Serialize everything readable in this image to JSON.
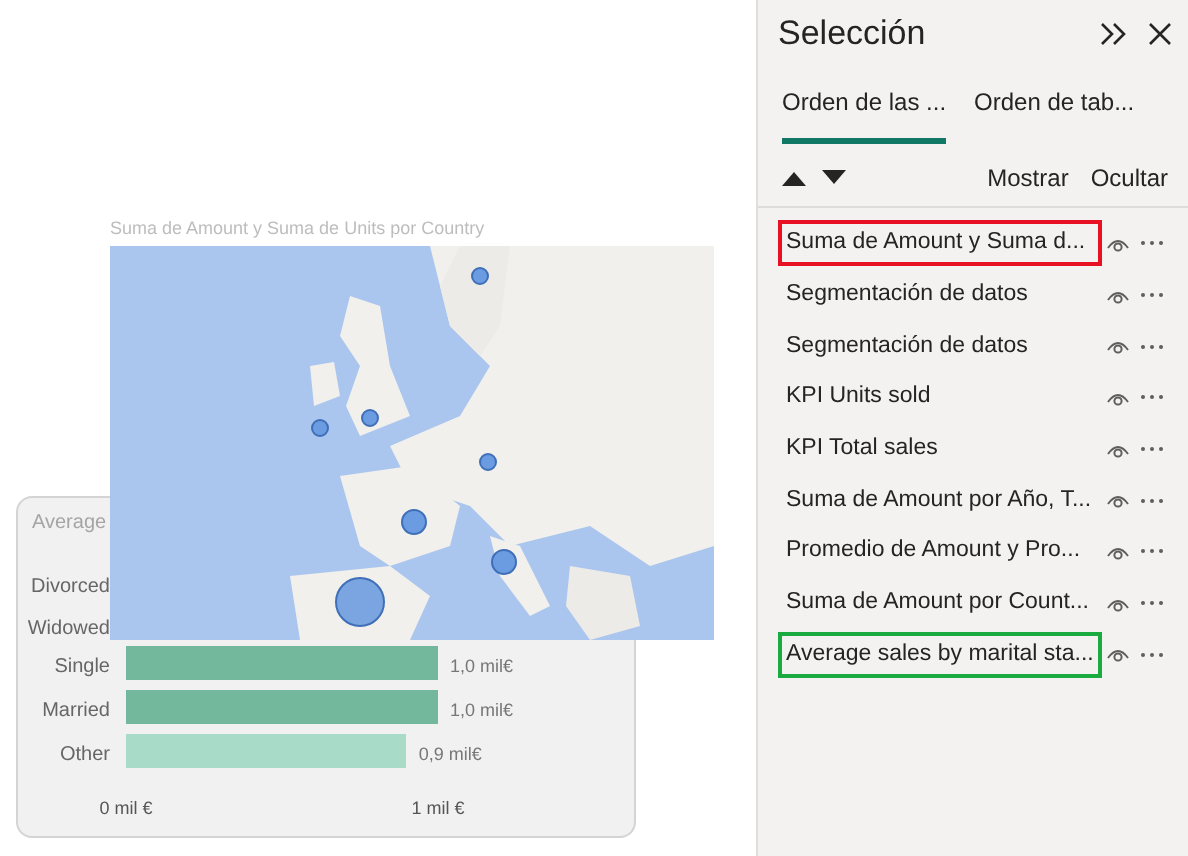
{
  "canvas": {
    "bar_chart": {
      "chart_data": {
        "type": "bar",
        "orientation": "horizontal",
        "title": "Average",
        "categories": [
          "Divorced",
          "Widowed",
          "Single",
          "Married",
          "Other"
        ],
        "series": [
          {
            "color": "#73b89c",
            "values": [
              null,
              null,
              1.0,
              1.0,
              null
            ]
          },
          {
            "color": "#a8dcc8",
            "values": [
              null,
              null,
              null,
              null,
              0.9
            ]
          }
        ],
        "value_labels": [
          null,
          null,
          "1,0 mil€",
          "1,0 mil€",
          "0,9 mil€"
        ],
        "xlim": [
          0,
          1
        ],
        "xticks": [
          {
            "value": 0,
            "label": "0 mil €"
          },
          {
            "value": 1,
            "label": "1 mil €"
          }
        ]
      }
    },
    "map": {
      "title": "Suma de Amount y Suma de Units por Country",
      "kind": "picture"
    }
  },
  "panel": {
    "title": "Selección",
    "tabs": [
      {
        "label": "Orden de las ...",
        "selected": true
      },
      {
        "label": "Orden de tab...",
        "selected": false
      }
    ],
    "actions": [
      "Mostrar",
      "Ocultar"
    ],
    "items": [
      {
        "label": "Suma de Amount y Suma d...",
        "color": "#e81123"
      },
      {
        "label": "Segmentación de datos"
      },
      {
        "label": "Segmentación de datos"
      },
      {
        "label": "KPI Units sold"
      },
      {
        "label": "KPI Total sales"
      },
      {
        "label": "Suma de Amount por Año, T..."
      },
      {
        "label": "Promedio de Amount y Pro..."
      },
      {
        "label": "Suma de Amount por Count..."
      },
      {
        "label": "Average sales by marital sta...",
        "color": "#1aab40"
      }
    ]
  }
}
